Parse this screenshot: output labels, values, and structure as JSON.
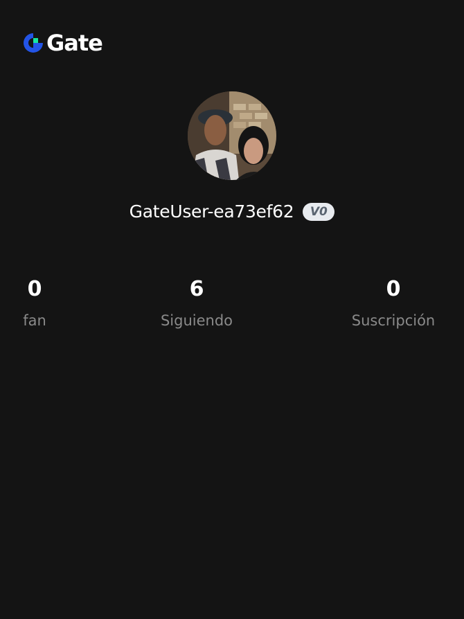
{
  "brand": {
    "name": "Gate",
    "mark_colors": [
      "#2354e6",
      "#17e6a1"
    ]
  },
  "profile": {
    "username": "GateUser-ea73ef62",
    "vip_level": "V0"
  },
  "stats": [
    {
      "value": "0",
      "label": "fan"
    },
    {
      "value": "6",
      "label": "Siguiendo"
    },
    {
      "value": "0",
      "label": "Suscripción"
    }
  ]
}
